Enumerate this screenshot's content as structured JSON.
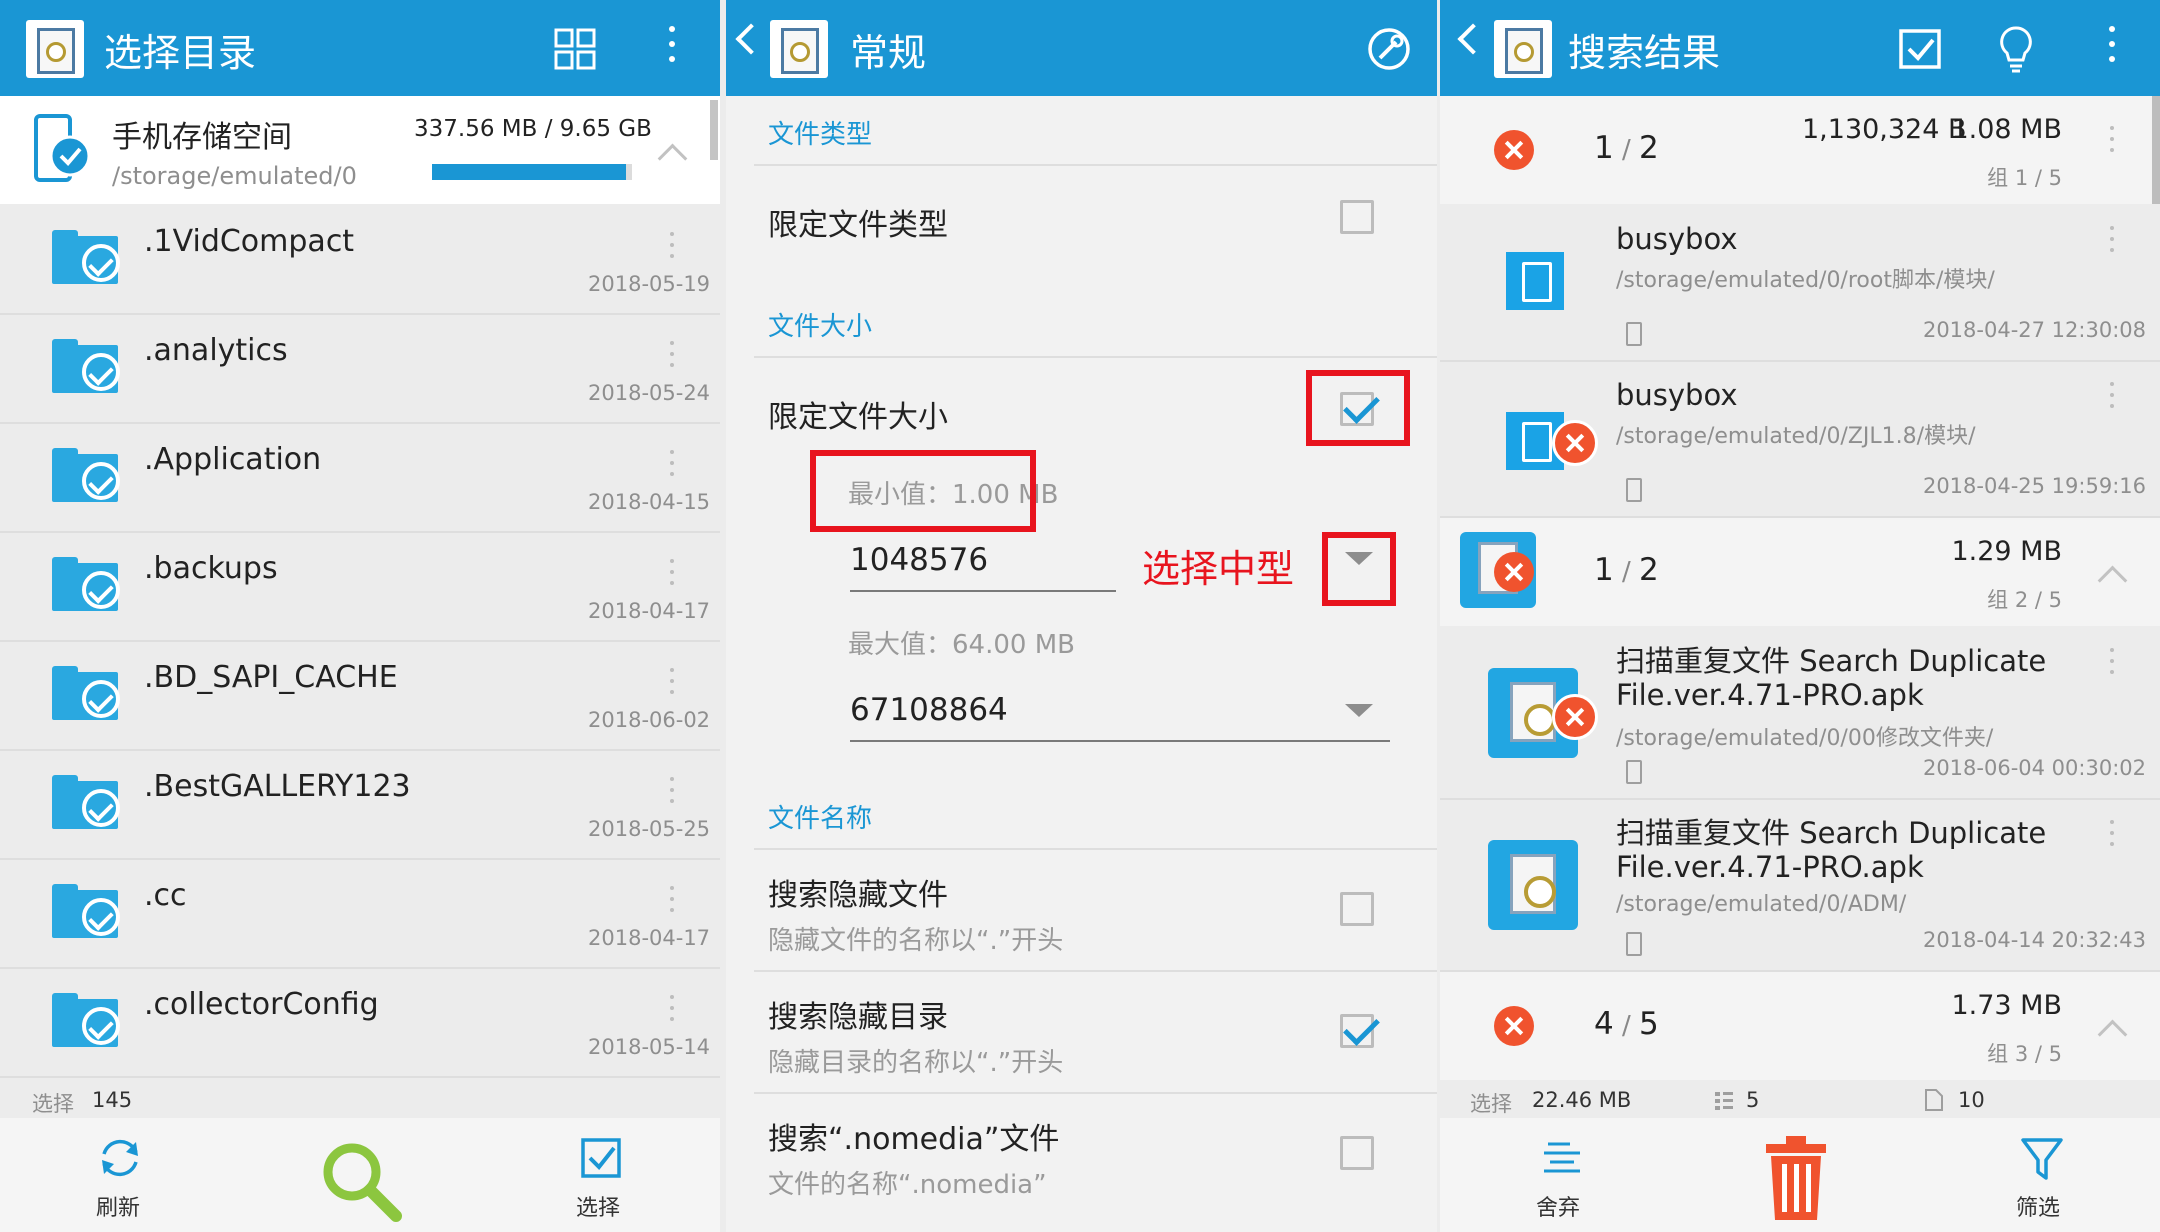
{
  "left": {
    "title": "选择目录",
    "storage": {
      "name": "手机存储空间",
      "path": "/storage/emulated/0",
      "usage": "337.56 MB / 9.65 GB",
      "fill": 0.97
    },
    "folders": [
      {
        "name": ".1VidCompact",
        "date": "2018-05-19"
      },
      {
        "name": ".analytics",
        "date": "2018-05-24"
      },
      {
        "name": ".Application",
        "date": "2018-04-15"
      },
      {
        "name": ".backups",
        "date": "2018-04-17"
      },
      {
        "name": ".BD_SAPI_CACHE",
        "date": "2018-06-02"
      },
      {
        "name": ".BestGALLERY123",
        "date": "2018-05-25"
      },
      {
        "name": ".cc",
        "date": "2018-04-17"
      },
      {
        "name": ".collectorConfig",
        "date": "2018-05-14"
      }
    ],
    "status": {
      "label": "选择",
      "count": "145"
    },
    "bottom": {
      "refresh": "刷新",
      "select": "选择"
    },
    "colors": {
      "accent": "#1a96d4",
      "search": "#8cc63f"
    }
  },
  "middle": {
    "title": "常规",
    "sections": {
      "type_header": "文件类型",
      "type_limit": "限定文件类型",
      "size_header": "文件大小",
      "size_limit": "限定文件大小",
      "min_label": "最小值：1.00 MB",
      "min_value": "1048576",
      "max_label": "最大值：64.00 MB",
      "max_value": "67108864",
      "name_header": "文件名称",
      "hidden_files": "搜索隐藏文件",
      "hidden_files_sub": "隐藏文件的名称以“.”开头",
      "hidden_dirs": "搜索隐藏目录",
      "hidden_dirs_sub": "隐藏目录的名称以“.”开头",
      "nomedia": "搜索“.nomedia”文件",
      "nomedia_sub": "文件的名称“.nomedia”"
    },
    "annotation": "选择中型",
    "checks": {
      "type_limit": false,
      "size_limit": true,
      "hidden_files": false,
      "hidden_dirs": true,
      "nomedia": false
    }
  },
  "right": {
    "title": "搜索结果",
    "groups": [
      {
        "count": "1",
        "total": "2",
        "bytes": "1,130,324 B",
        "size": "1.08 MB",
        "group": "组 1 / 5"
      },
      {
        "count": "1",
        "total": "2",
        "size": "1.29 MB",
        "group": "组 2 / 5"
      },
      {
        "count": "4",
        "total": "5",
        "size": "1.73 MB",
        "group": "组 3 / 5"
      }
    ],
    "files": [
      {
        "name": "busybox",
        "path": "/storage/emulated/0/root脚本/模块/",
        "date": "2018-04-27 12:30:08"
      },
      {
        "name": "busybox",
        "path": "/storage/emulated/0/ZJL1.8/模块/",
        "date": "2018-04-25 19:59:16"
      },
      {
        "name": "扫描重复文件 Search Duplicate",
        "name2": "File.ver.4.71-PRO.apk",
        "path": "/storage/emulated/0/00修改文件夹/",
        "date": "2018-06-04 00:30:02"
      },
      {
        "name": "扫描重复文件 Search Duplicate",
        "name2": "File.ver.4.71-PRO.apk",
        "path": "/storage/emulated/0/ADM/",
        "date": "2018-04-14 20:32:43"
      }
    ],
    "status": {
      "label": "选择",
      "size": "22.46 MB",
      "groups": "5",
      "files": "10"
    },
    "bottom": {
      "discard": "舍弃",
      "filter": "筛选"
    },
    "colors": {
      "delete": "#f0532e"
    }
  }
}
